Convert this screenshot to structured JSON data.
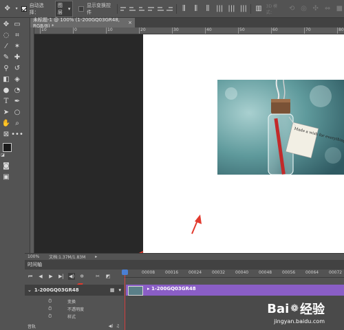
{
  "options_bar": {
    "auto_select_label": "自动选择：",
    "auto_select_value": "图层",
    "show_transform_label": "显示变换控件",
    "mode_3d_label": "3D 模式："
  },
  "document_tab": {
    "title": "未标题-1 @ 100% (1-200GQ03GR48, RGB/8) *",
    "close": "×"
  },
  "ruler": {
    "h_ticks": [
      "10",
      "0",
      "10",
      "20",
      "30",
      "40",
      "50",
      "60",
      "70",
      "80"
    ]
  },
  "status_bar": {
    "zoom": "100%",
    "doc_info": "文档:1.37M/1.83M"
  },
  "timeline": {
    "panel_title": "时间轴",
    "layer_name": "1-200GQ03GR48",
    "track_label": "1-200GQ03GR48",
    "properties": [
      "变换",
      "不透明度",
      "样式"
    ],
    "audio_label": "音轨",
    "time_ticks": [
      "00008",
      "00016",
      "00024",
      "00032",
      "00040",
      "00048",
      "00056",
      "00064",
      "00072"
    ]
  },
  "photo": {
    "tag_text": "Made a wish for everything"
  },
  "watermark": {
    "brand_left": "Bai",
    "brand_right": "经验",
    "url": "jingyan.baidu.com"
  },
  "colors": {
    "annotation_arrow": "#e23a2e",
    "track_purple": "#8a5ec6",
    "playhead_blue": "#4a7fd3"
  }
}
